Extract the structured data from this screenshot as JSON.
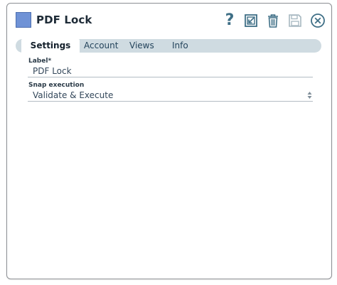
{
  "window": {
    "title": "PDF Lock",
    "accent": "#6f92d6"
  },
  "toolbar": {
    "icons": [
      "help-icon",
      "export-icon",
      "delete-icon",
      "save-icon",
      "close-icon"
    ],
    "help_glyph": "?"
  },
  "tabs": [
    {
      "label": "Settings",
      "active": true
    },
    {
      "label": "Account",
      "active": false
    },
    {
      "label": "Views",
      "active": false
    },
    {
      "label": "Info",
      "active": false
    }
  ],
  "settings": {
    "label_field": {
      "label": "Label*",
      "value": "PDF Lock"
    },
    "snap_execution": {
      "label": "Snap execution",
      "value": "Validate & Execute"
    }
  }
}
